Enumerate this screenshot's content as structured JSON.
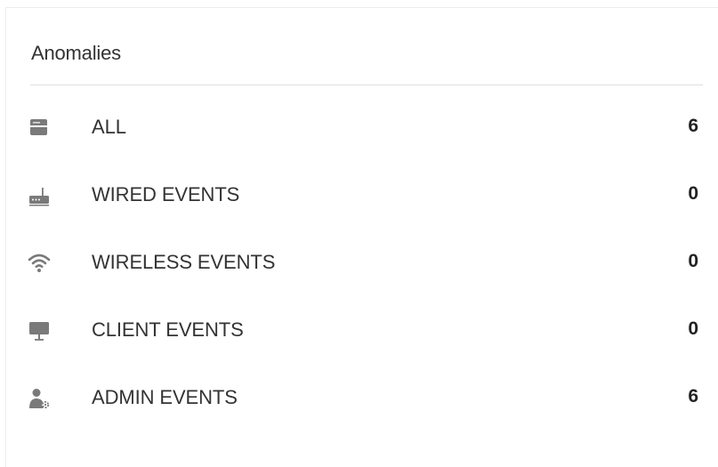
{
  "panel": {
    "title": "Anomalies"
  },
  "rows": [
    {
      "label": "ALL",
      "count": "6",
      "icon": "server-icon"
    },
    {
      "label": "WIRED EVENTS",
      "count": "0",
      "icon": "router-icon"
    },
    {
      "label": "WIRELESS EVENTS",
      "count": "0",
      "icon": "wifi-icon"
    },
    {
      "label": "CLIENT EVENTS",
      "count": "0",
      "icon": "monitor-icon"
    },
    {
      "label": "ADMIN EVENTS",
      "count": "6",
      "icon": "admin-user-icon"
    }
  ],
  "colors": {
    "icon": "#7a7a7a",
    "text": "#333333",
    "divider": "#e0e0e0"
  }
}
